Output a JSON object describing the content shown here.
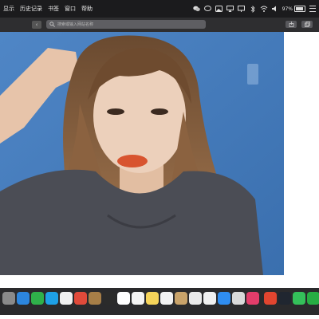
{
  "menubar": {
    "items": [
      {
        "label": "显示"
      },
      {
        "label": "历史记录"
      },
      {
        "label": "书签"
      },
      {
        "label": "窗口"
      },
      {
        "label": "帮助"
      }
    ],
    "status_icons": [
      "wechat-icon",
      "messages-icon",
      "photos-icon",
      "airplay-icon",
      "monitor-icon",
      "bluetooth-icon",
      "wifi-icon",
      "volume-icon"
    ],
    "battery_percent": "97%",
    "battery_level": 0.97
  },
  "toolbar": {
    "back_icon": "chevron-left-icon",
    "search_placeholder": "搜索或输入网站名称",
    "share_icon": "share-icon",
    "tabs_icon": "tabs-icon"
  },
  "content": {
    "image_subject": "photo"
  },
  "dock": {
    "apps": [
      {
        "name": "launchpad-icon",
        "color": "#8a8a8a"
      },
      {
        "name": "safari-icon",
        "color": "#2c86de"
      },
      {
        "name": "wechat-icon",
        "color": "#2fb14a"
      },
      {
        "name": "qq-icon",
        "color": "#1ea0e6"
      },
      {
        "name": "photos-icon",
        "color": "#f0f0f0"
      },
      {
        "name": "chrome-icon",
        "color": "#e04a3a"
      },
      {
        "name": "notes-app-icon",
        "color": "#a77e47"
      },
      {
        "name": "finder-icon",
        "color": "#2b2b2b"
      },
      {
        "name": "calendar-icon",
        "color": "#ffffff"
      },
      {
        "name": "reminders-icon",
        "color": "#f4f4f4"
      },
      {
        "name": "notes-icon",
        "color": "#f6d45a"
      },
      {
        "name": "music-icon",
        "color": "#f2f2f2"
      },
      {
        "name": "contacts-icon",
        "color": "#c9a36a"
      },
      {
        "name": "app-store-grid-icon",
        "color": "#eaeaea"
      },
      {
        "name": "pages-icon",
        "color": "#f0f0f0"
      },
      {
        "name": "app-store-icon",
        "color": "#2f8df0"
      },
      {
        "name": "screenshot-icon",
        "color": "#d9d9d9"
      },
      {
        "name": "itunes-icon",
        "color": "#e33d6a"
      },
      {
        "name": "tomato-icon",
        "color": "#e2452f"
      },
      {
        "name": "quicktime-icon",
        "color": "#202630"
      },
      {
        "name": "messages-icon",
        "color": "#34c05a"
      },
      {
        "name": "wechat-work-icon",
        "color": "#27ad43"
      },
      {
        "name": "trash-icon",
        "color": "#8c8c8c"
      }
    ]
  }
}
